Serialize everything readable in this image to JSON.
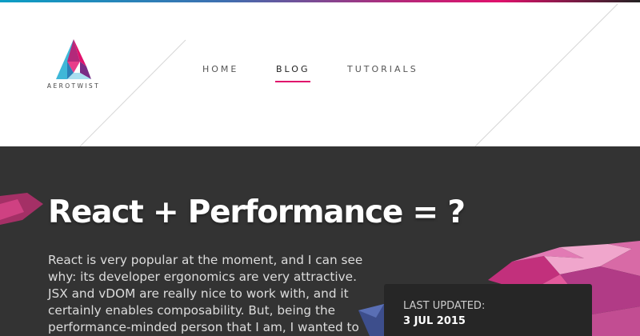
{
  "brand": {
    "name": "AEROTWIST",
    "icon": "aerotwist-triangle-logo-icon"
  },
  "nav": {
    "items": [
      {
        "label": "HOME"
      },
      {
        "label": "BLOG"
      },
      {
        "label": "TUTORIALS"
      }
    ],
    "active": "BLOG"
  },
  "colors": {
    "accent": "#e0116c",
    "hero_bg": "#333333",
    "card_bg": "#262626",
    "topbar_gradient": [
      "#0c9ec4",
      "#3e6fb0",
      "#b3297a",
      "#e0116c",
      "#222222"
    ]
  },
  "article": {
    "title": "React + Performance = ?",
    "intro": "React is very popular at the moment, and I can see why: its developer ergonomics are very attractive. JSX and vDOM are really nice to work with, and it certainly enables composability. But, being the performance-minded person that I am, I wanted to"
  },
  "meta": {
    "label": "LAST UPDATED:",
    "date": "3 JUL 2015"
  }
}
